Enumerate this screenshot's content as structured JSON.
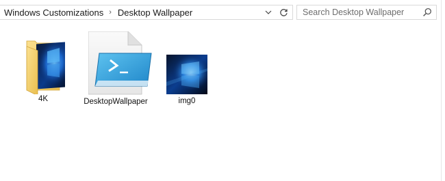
{
  "breadcrumb": {
    "items": [
      "Windows Customizations",
      "Desktop Wallpaper"
    ],
    "separator": "›"
  },
  "search": {
    "placeholder": "Search Desktop Wallpaper",
    "value": ""
  },
  "files": [
    {
      "name": "4K",
      "kind": "folder",
      "icon": "folder-icon"
    },
    {
      "name": "DesktopWallpaper",
      "kind": "powershell-script",
      "icon": "powershell-file-icon"
    },
    {
      "name": "img0",
      "kind": "image",
      "icon": "image-thumbnail"
    }
  ],
  "colors": {
    "folder_yellow": "#f6d26b",
    "windows_blue": "#1e6fd9",
    "powershell_blue": "#2f9ed9"
  }
}
